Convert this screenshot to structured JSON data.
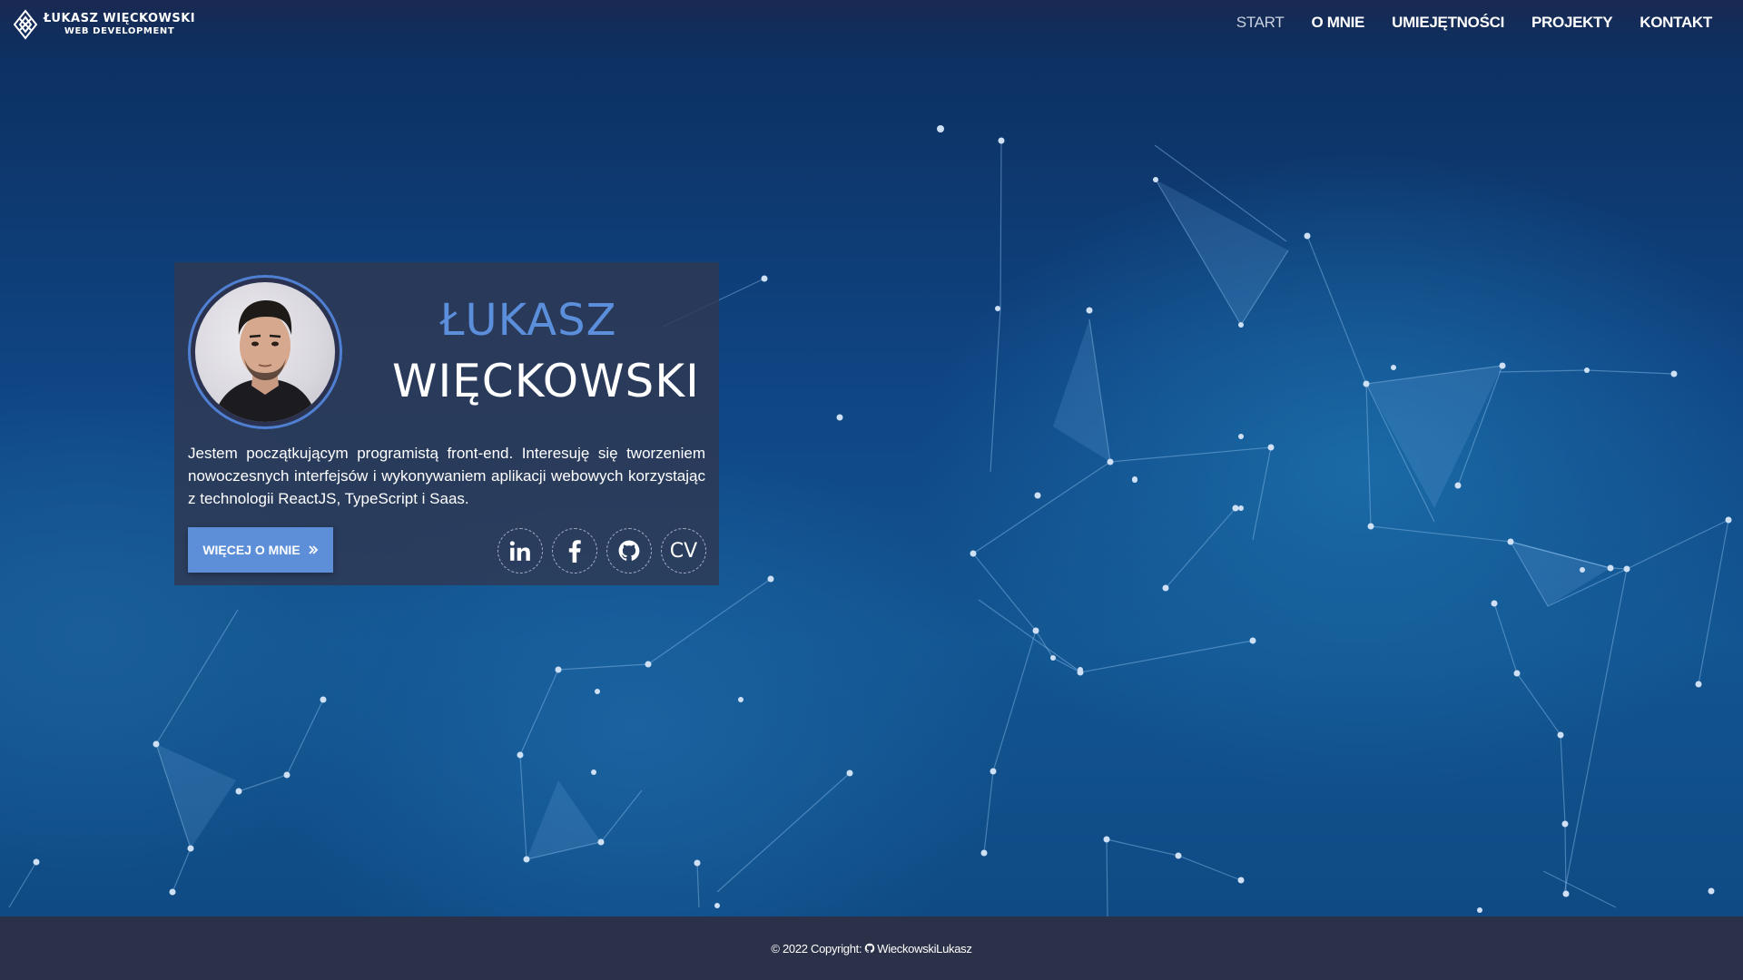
{
  "brand": {
    "name": "ŁUKASZ WIĘCKOWSKI",
    "subtitle": "WEB DEVELOPMENT"
  },
  "nav": {
    "items": [
      {
        "label": "START",
        "active": true
      },
      {
        "label": "O MNIE",
        "active": false
      },
      {
        "label": "UMIEJĘTNOŚCI",
        "active": false
      },
      {
        "label": "PROJEKTY",
        "active": false
      },
      {
        "label": "KONTAKT",
        "active": false
      }
    ]
  },
  "hero": {
    "first_name": "ŁUKASZ",
    "last_name": "WIĘCKOWSKI",
    "bio": "Jestem początkującym programistą front-end. Interesuję się tworzeniem nowoczesnych interfejsów i wykonywaniem aplikacji webowych korzystając z technologii ReactJS, TypeScript i Saas.",
    "more_button": "WIĘCEJ O MNIE",
    "socials": [
      {
        "icon": "linkedin-icon"
      },
      {
        "icon": "facebook-icon"
      },
      {
        "icon": "github-icon"
      },
      {
        "icon": "cv",
        "label": "CV"
      }
    ]
  },
  "footer": {
    "copyright": "© 2022 Copyright:",
    "author": "WieckowskiLukasz"
  },
  "colors": {
    "accent": "#5d8fd8",
    "name_accent": "#5b8fdc",
    "card_bg": "#303852",
    "footer_bg": "#2b3148",
    "hero_bg": "#0f4482"
  }
}
